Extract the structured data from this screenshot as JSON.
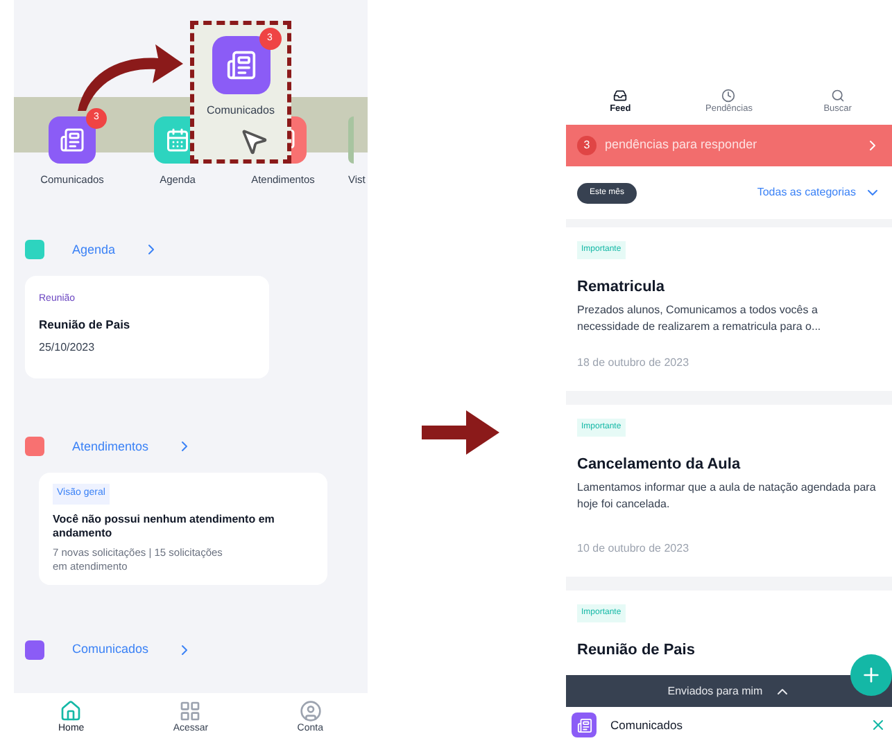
{
  "home_screen": {
    "shortcuts": [
      {
        "label": "Comunicados",
        "kind": "comunicados",
        "badge": "3"
      },
      {
        "label": "Agenda",
        "kind": "agenda"
      },
      {
        "label": "Atendimentos",
        "kind": "atendimentos"
      },
      {
        "label": "Vist",
        "kind": "cut"
      }
    ],
    "zoom_callout": {
      "label": "Comunicados",
      "badge": "3"
    },
    "agenda": {
      "title": "Agenda",
      "card": {
        "tag": "Reunião",
        "title": "Reunião de Pais",
        "date": "25/10/2023"
      }
    },
    "atendimentos": {
      "title": "Atendimentos",
      "card": {
        "tag": "Visão geral",
        "title": "Você não possui nenhum atendimento em andamento",
        "detail": "7 novas solicitações | 15 solicitações em atendimento"
      }
    },
    "comunicados": {
      "title": "Comunicados"
    },
    "bottom_nav": [
      {
        "label": "Home",
        "kind": "home",
        "selected": true
      },
      {
        "label": "Acessar",
        "kind": "grid",
        "selected": false
      },
      {
        "label": "Conta",
        "kind": "user",
        "selected": false
      }
    ]
  },
  "feed_screen": {
    "tabs": [
      {
        "label": "Feed",
        "selected": true
      },
      {
        "label": "Pendências",
        "selected": false
      },
      {
        "label": "Buscar",
        "selected": false
      }
    ],
    "pending_banner": {
      "count": "3",
      "text": "pendências para responder"
    },
    "period_filter": "Este mês",
    "category_filter": "Todas as categorias",
    "posts": [
      {
        "tag": "Importante",
        "title": "Rematricula",
        "body": "Prezados alunos, Comunicamos a todos vocês a necessidade de realizarem a rematricula para o...",
        "date": "18 de outubro de 2023"
      },
      {
        "tag": "Importante",
        "title": "Cancelamento da Aula",
        "body": "Lamentamos informar que a aula de natação agendada para hoje foi cancelada.",
        "date": "10 de outubro de 2023"
      },
      {
        "tag": "Importante",
        "title": "Reunião de Pais"
      }
    ],
    "sent_bar": "Enviados para mim",
    "module_bar": {
      "label": "Comunicados"
    }
  }
}
